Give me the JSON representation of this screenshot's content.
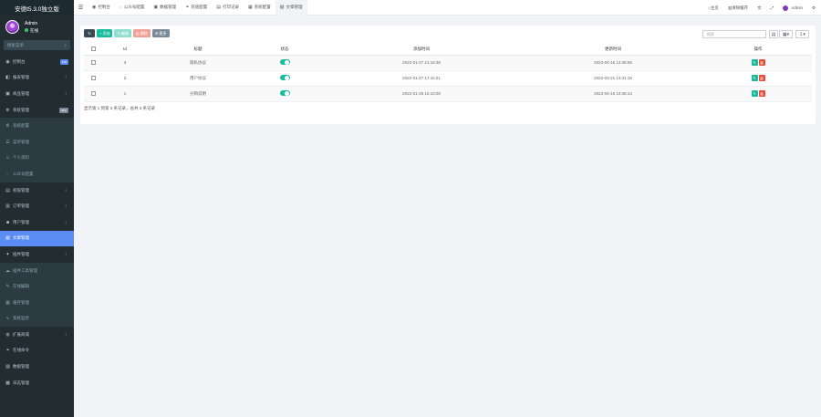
{
  "brand": "安德t5.3.0独立版",
  "user": {
    "name": "Admin",
    "status": "在线"
  },
  "search": {
    "placeholder": "搜索菜单"
  },
  "sidebar": {
    "items": [
      {
        "icon": "dashboard-icon",
        "glyph": "◉",
        "label": "控制台",
        "badge": "hot",
        "badge_color": "#5b8cf4"
      },
      {
        "icon": "report-icon",
        "glyph": "◧",
        "label": "报表管理",
        "arrow": true
      },
      {
        "icon": "product-icon",
        "glyph": "▣",
        "label": "商品管理",
        "arrow": true
      },
      {
        "icon": "settings-icon",
        "glyph": "⚙",
        "label": "系统管理",
        "badge": "new",
        "badge_color": "#7a8a99"
      },
      {
        "icon": "gear-icon",
        "glyph": "⚙",
        "label": "系统配置",
        "sub": true
      },
      {
        "icon": "list-icon",
        "glyph": "☰",
        "label": "菜单管理",
        "sub": true
      },
      {
        "icon": "person-icon",
        "glyph": "☺",
        "label": "个人资料",
        "sub": true
      },
      {
        "icon": "wechat-icon",
        "glyph": "◌",
        "label": "公众号配置",
        "sub": true
      },
      {
        "icon": "permission-icon",
        "glyph": "▤",
        "label": "权限管理",
        "arrow": true
      },
      {
        "icon": "order-icon",
        "glyph": "▥",
        "label": "订单管理",
        "arrow": true
      },
      {
        "icon": "users-icon",
        "glyph": "☻",
        "label": "用户管理",
        "arrow": true
      },
      {
        "icon": "article-icon",
        "glyph": "▧",
        "label": "文章管理",
        "active": true
      },
      {
        "icon": "pin-icon",
        "glyph": "✦",
        "label": "插件管理",
        "arrow": true
      },
      {
        "icon": "chat-icon",
        "glyph": "☁",
        "label": "插件工具管理",
        "sub": true
      },
      {
        "icon": "edit-icon",
        "glyph": "✎",
        "label": "在线编辑",
        "sub": true
      },
      {
        "icon": "table-icon",
        "glyph": "▦",
        "label": "缓存管理",
        "sub": true
      },
      {
        "icon": "chart-icon",
        "glyph": "∿",
        "label": "系统监控",
        "sub": true
      },
      {
        "icon": "cloud-icon",
        "glyph": "◍",
        "label": "扩展商城",
        "arrow": true
      },
      {
        "icon": "link-icon",
        "glyph": "⚭",
        "label": "在线命令"
      },
      {
        "icon": "data-icon",
        "glyph": "▨",
        "label": "数据管理"
      },
      {
        "icon": "log-icon",
        "glyph": "▩",
        "label": "日志管理"
      }
    ]
  },
  "topbar": {
    "tabs": [
      {
        "icon": "dashboard-icon",
        "glyph": "◉",
        "label": "控制台"
      },
      {
        "icon": "wechat-icon",
        "glyph": "◌",
        "label": "公众号配置"
      },
      {
        "icon": "image-icon",
        "glyph": "▣",
        "label": "数据管理"
      },
      {
        "icon": "link-icon",
        "glyph": "⚭",
        "label": "充值配置"
      },
      {
        "icon": "print-icon",
        "glyph": "▤",
        "label": "打印记录"
      },
      {
        "icon": "grid-icon",
        "glyph": "▦",
        "label": "系统配置"
      },
      {
        "icon": "article-icon",
        "glyph": "▧",
        "label": "文章管理",
        "active": true
      }
    ],
    "right": {
      "home": "主页",
      "clear_cache": "清除缓存",
      "admin": "Admin"
    }
  },
  "toolbar": {
    "add": "添加",
    "edit": "编辑",
    "delete": "删除",
    "more": "更多",
    "search_placeholder": "搜索"
  },
  "table": {
    "headers": {
      "id": "Id",
      "title": "标题",
      "status": "状态",
      "created": "添加时间",
      "updated": "更新时间",
      "ops": "操作"
    },
    "rows": [
      {
        "id": "3",
        "title": "隐私协议",
        "status": true,
        "created": "2022-01-27 21:16:38",
        "updated": "2023-04-15 13:35:56"
      },
      {
        "id": "2",
        "title": "用户协议",
        "status": true,
        "created": "2022-01-27 17:42:21",
        "updated": "2022-03-21 13:31:19"
      },
      {
        "id": "1",
        "title": "分销说明",
        "status": true,
        "created": "2022-01-26 16:10:00",
        "updated": "2023-04-15 13:35:14"
      }
    ],
    "footer": "显示第 1 到第 3 条记录，总共 3 条记录"
  },
  "colors": {
    "accent": "#18bc9c",
    "danger": "#e74c3c",
    "sidebar_bg": "#222d32",
    "active": "#5b8cf4"
  }
}
